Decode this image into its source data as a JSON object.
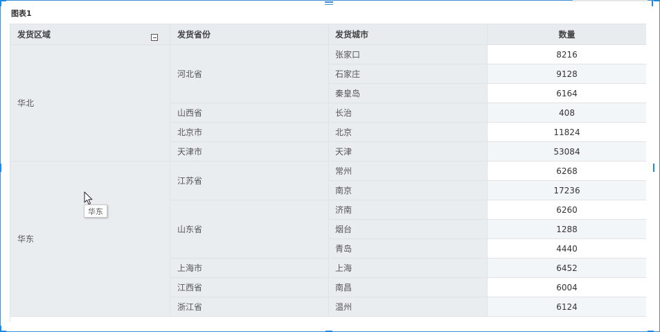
{
  "widget": {
    "title": "图表1"
  },
  "columns": [
    "发货区域",
    "发货省份",
    "发货城市",
    "数量"
  ],
  "regions": [
    {
      "name": "华北",
      "provinces": [
        {
          "name": "河北省",
          "cities": [
            {
              "city": "张家口",
              "qty": "8216"
            },
            {
              "city": "石家庄",
              "qty": "9128"
            },
            {
              "city": "秦皇岛",
              "qty": "6164"
            }
          ]
        },
        {
          "name": "山西省",
          "cities": [
            {
              "city": "长治",
              "qty": "408"
            }
          ]
        },
        {
          "name": "北京市",
          "cities": [
            {
              "city": "北京",
              "qty": "11824"
            }
          ]
        },
        {
          "name": "天津市",
          "cities": [
            {
              "city": "天津",
              "qty": "53084"
            }
          ]
        }
      ]
    },
    {
      "name": "华东",
      "provinces": [
        {
          "name": "江苏省",
          "cities": [
            {
              "city": "常州",
              "qty": "6268"
            },
            {
              "city": "南京",
              "qty": "17236"
            }
          ]
        },
        {
          "name": "山东省",
          "cities": [
            {
              "city": "济南",
              "qty": "6260"
            },
            {
              "city": "烟台",
              "qty": "1288"
            },
            {
              "city": "青岛",
              "qty": "4440"
            }
          ]
        },
        {
          "name": "上海市",
          "cities": [
            {
              "city": "上海",
              "qty": "6452"
            }
          ]
        },
        {
          "name": "江西省",
          "cities": [
            {
              "city": "南昌",
              "qty": "6004"
            }
          ]
        },
        {
          "name": "浙江省",
          "cities": [
            {
              "city": "温州",
              "qty": "6124"
            }
          ]
        }
      ]
    }
  ],
  "tooltip": {
    "text": "华东"
  },
  "icons": {
    "collapse": "minus-square-icon",
    "drag": "drag-handle-icon",
    "cursor": "mouse-pointer-icon"
  },
  "colors": {
    "selection": "#1e88e5",
    "header_bg": "#e8ecef",
    "dimension_bg": "#e9edf0",
    "stripe_bg": "#f3f6f8"
  }
}
